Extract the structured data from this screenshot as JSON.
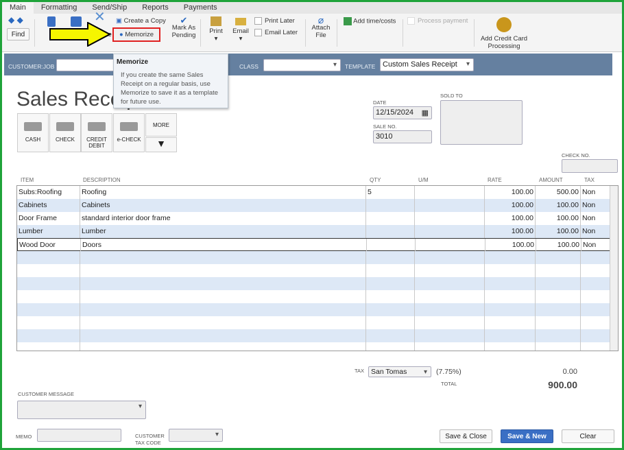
{
  "tabs": [
    "Main",
    "Formatting",
    "Send/Ship",
    "Reports",
    "Payments"
  ],
  "toolbar": {
    "find": "Find",
    "create_copy": "Create a Copy",
    "memorize": "Memorize",
    "mark_pending": "Mark As Pending",
    "print": "Print",
    "email": "Email",
    "print_later": "Print Later",
    "email_later": "Email Later",
    "attach_file": "Attach File",
    "add_time": "Add time/costs",
    "process_payment": "Process payment",
    "add_cc": "Add Credit Card Processing",
    "delete_partial": "te"
  },
  "tooltip": {
    "title": "Memorize",
    "body": "If you create the same Sales Receipt on a regular basis, use Memorize to save it as a template for future use."
  },
  "header": {
    "customer_job_label": "CUSTOMER:JOB",
    "customer_job": "",
    "class_label": "CLASS",
    "class": "",
    "template_label": "TEMPLATE",
    "template": "Custom Sales Receipt"
  },
  "form": {
    "title": "Sales Receipt",
    "date_label": "DATE",
    "date": "12/15/2024",
    "sale_no_label": "SALE NO.",
    "sale_no": "3010",
    "sold_to_label": "SOLD TO",
    "check_no_label": "CHECK NO."
  },
  "payment_methods": [
    "CASH",
    "CHECK",
    "CREDIT DEBIT",
    "e-CHECK",
    "MORE"
  ],
  "table": {
    "headers": [
      "ITEM",
      "DESCRIPTION",
      "QTY",
      "U/M",
      "RATE",
      "AMOUNT",
      "TAX"
    ],
    "rows": [
      {
        "item": "Subs:Roofing",
        "desc": "Roofing",
        "qty": "5",
        "um": "",
        "rate": "100.00",
        "amount": "500.00",
        "tax": "Non"
      },
      {
        "item": "Cabinets",
        "desc": "Cabinets",
        "qty": "",
        "um": "",
        "rate": "100.00",
        "amount": "100.00",
        "tax": "Non"
      },
      {
        "item": "Door Frame",
        "desc": "standard interior door frame",
        "qty": "",
        "um": "",
        "rate": "100.00",
        "amount": "100.00",
        "tax": "Non"
      },
      {
        "item": "Lumber",
        "desc": "Lumber",
        "qty": "",
        "um": "",
        "rate": "100.00",
        "amount": "100.00",
        "tax": "Non"
      },
      {
        "item": "Wood Door",
        "desc": "Doors",
        "qty": "",
        "um": "",
        "rate": "100.00",
        "amount": "100.00",
        "tax": "Non"
      }
    ]
  },
  "footer": {
    "tax_label": "TAX",
    "tax_item": "San Tomas",
    "tax_rate": "(7.75%)",
    "tax_amount": "0.00",
    "total_label": "TOTAL",
    "total": "900.00",
    "customer_message_label": "CUSTOMER MESSAGE",
    "memo_label": "MEMO",
    "customer_tax_code_label": "CUSTOMER TAX CODE",
    "save_close": "Save & Close",
    "save_new": "Save & New",
    "clear": "Clear"
  },
  "colors": {
    "accent": "#3a6fc4",
    "bar": "#6580a0",
    "highlight": "#e02020",
    "arrow": "#f5f500"
  }
}
